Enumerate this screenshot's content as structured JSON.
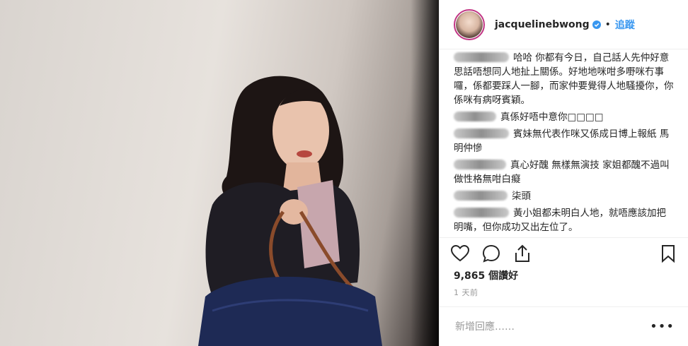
{
  "post": {
    "username": "jacquelinebwong",
    "verified_icon": "verified-badge-icon",
    "separator": "•",
    "follow_label": "追蹤"
  },
  "comments": [
    {
      "text": "哈哈 你都有今日，自己話人先仲好意思話唔想同人地扯上關係。好地地咪咁多嘢咪冇事囉，係都要踩人一腳，而家仲要覺得人地騷擾你，你係咪有病呀賓穎。"
    },
    {
      "text": "真係好唔中意你□□□□"
    },
    {
      "text": "賓妹無代表作咪又係成日博上報紙 馬明仲慘"
    },
    {
      "text": "真心好醜 無樣無演技 家姐都醜不過叫做性格無咁白癡"
    },
    {
      "text": "柒頭"
    },
    {
      "text": "黃小姐都未明白人地，就唔應該加把明嘴，但你成功又出左位了。"
    }
  ],
  "actions": {
    "like_icon": "heart-icon",
    "comment_icon": "comment-bubble-icon",
    "share_icon": "share-icon",
    "save_icon": "bookmark-icon"
  },
  "likes_text": "9,865 個讚好",
  "timestamp": "1 天前",
  "add_comment": {
    "placeholder": "新增回應……",
    "more_label": "•••"
  },
  "colors": {
    "link": "#3897f0",
    "text": "#262626",
    "muted": "#999999",
    "story_ring": "#c13584"
  }
}
